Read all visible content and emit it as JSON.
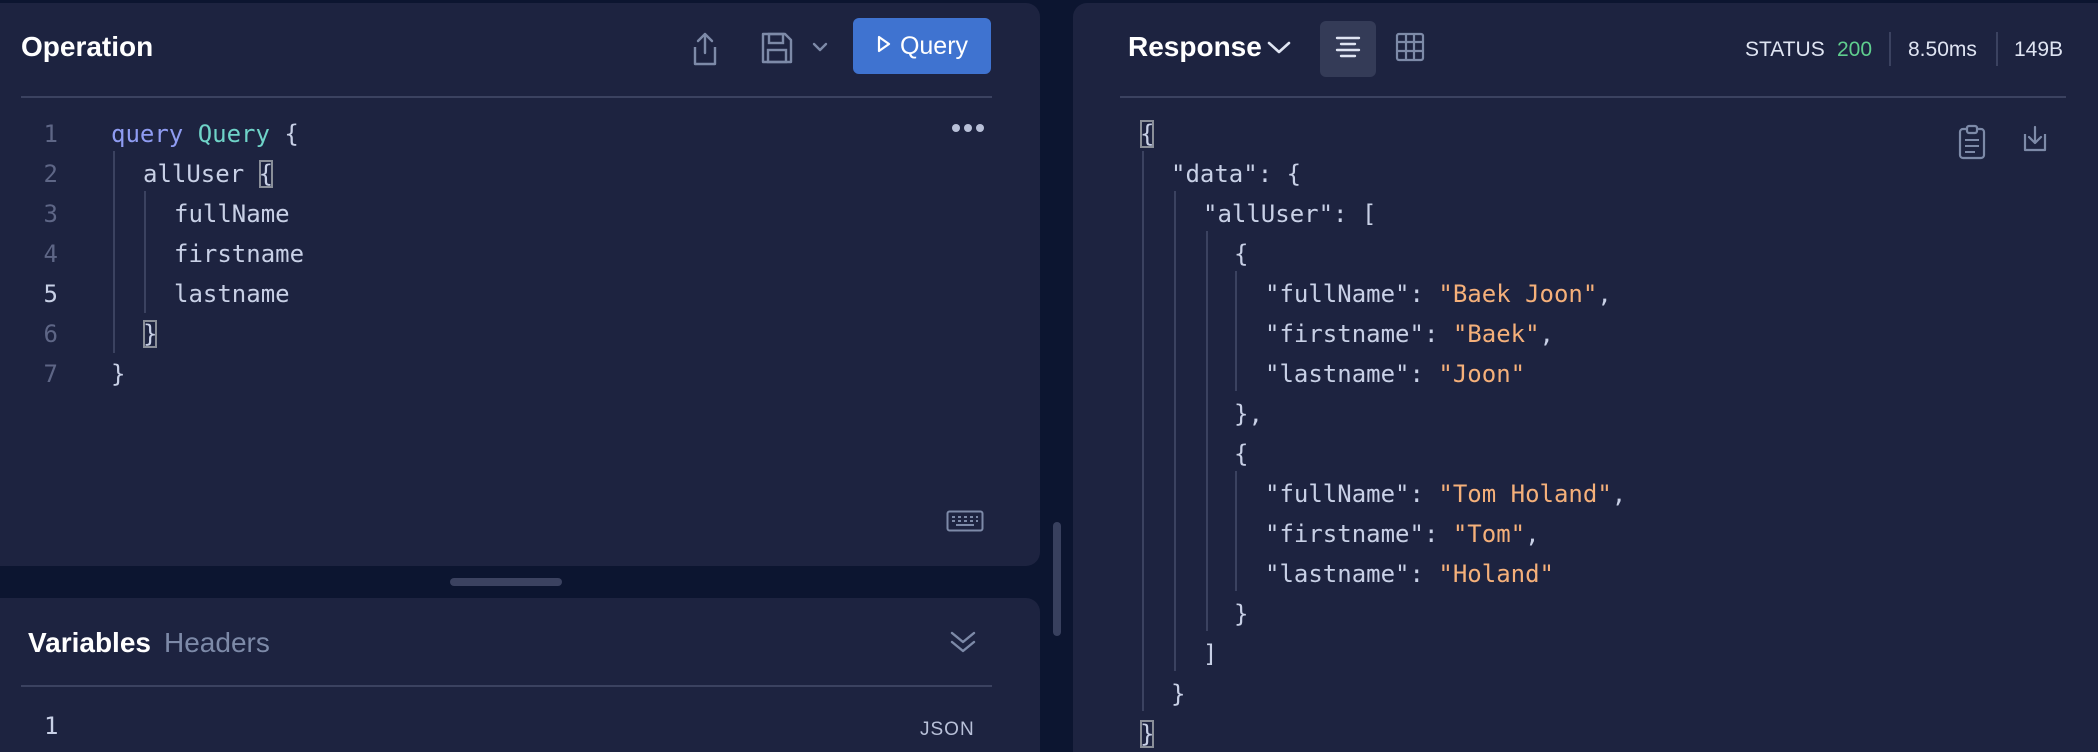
{
  "operation": {
    "title": "Operation",
    "query_button_label": "Query",
    "editor": {
      "line_numbers": [
        "1",
        "2",
        "3",
        "4",
        "5",
        "6",
        "7"
      ],
      "active_line": "5",
      "lines": [
        {
          "kw": "query",
          "name": "Query",
          "rest": " {"
        },
        {
          "field": "allUser",
          "rest": "{"
        },
        {
          "field": "fullName"
        },
        {
          "field": "firstname"
        },
        {
          "field": "lastname"
        },
        {
          "rest": "}"
        },
        {
          "rest": "}"
        }
      ]
    }
  },
  "bottom": {
    "tabs": [
      {
        "label": "Variables",
        "active": true
      },
      {
        "label": "Headers",
        "active": false
      }
    ],
    "line_number": "1",
    "format_label": "JSON"
  },
  "response": {
    "title": "Response",
    "status_label": "STATUS",
    "status_code": "200",
    "duration": "8.50ms",
    "size": "149B",
    "json_lines": [
      "{",
      "\"data\": {",
      "\"allUser\": [",
      "{",
      "\"fullName\": \"Baek Joon\",",
      "\"firstname\": \"Baek\",",
      "\"lastname\": \"Joon\"",
      "},",
      "{",
      "\"fullName\": \"Tom Holand\",",
      "\"firstname\": \"Tom\",",
      "\"lastname\": \"Holand\"",
      "}",
      "]",
      "}",
      "}"
    ]
  },
  "colors": {
    "accent": "#3f73d0",
    "status_ok": "#5fce8e",
    "string": "#f5b07a",
    "keyword": "#8f9cf2",
    "type_name": "#6fd3c8"
  },
  "icons": {
    "share": "share-icon",
    "save": "save-icon",
    "chevron": "chevron-down-icon",
    "play": "play-icon",
    "more": "more-icon",
    "keyboard": "keyboard-icon",
    "collapse": "collapse-icon",
    "text_view": "text-view-icon",
    "table_view": "table-icon",
    "copy": "clipboard-icon",
    "download": "download-icon"
  }
}
